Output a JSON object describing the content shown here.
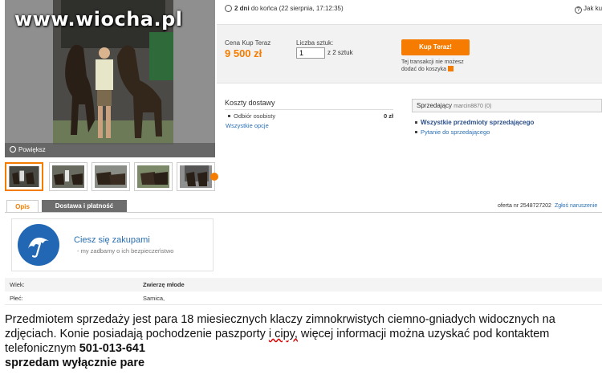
{
  "watermark": "www.wiocha.pl",
  "gallery": {
    "zoom_label": "Powiększ",
    "thumb_count": 5
  },
  "auction": {
    "time_left_bold": "2 dni",
    "time_left_rest": " do końca (22 sierpnia, 17:12:35)",
    "help_label": "Jak ku"
  },
  "buy": {
    "price_label": "Cena Kup Teraz",
    "price": "9 500 zł",
    "qty_label": "Liczba sztuk:",
    "qty_value": "1",
    "qty_of": "z 2 sztuk",
    "buy_button": "Kup Teraz!",
    "cart_note": "Tej transakcji nie możesz dodać do koszyka"
  },
  "shipping": {
    "title": "Koszty dostawy",
    "item": "Odbiór osobisty",
    "price": "0 zł",
    "all_options": "Wszystkie opcje"
  },
  "seller": {
    "label": "Sprzedający",
    "nick": "marcin8870 (0)",
    "all_items": "Wszystkie przedmioty sprzedającego",
    "ask": "Pytanie do sprzedającego"
  },
  "tabs": {
    "opis": "Opis",
    "dostawa": "Dostawa i płatność",
    "offer_number": "oferta nr 2548727202",
    "report": "Zgłoś naruszenie"
  },
  "safety": {
    "title": "Ciesz się zakupami",
    "subtitle": "- my zadbamy o ich bezpieczeństwo"
  },
  "attributes": [
    {
      "key": "Wiek:",
      "value": "Zwierzę młode"
    },
    {
      "key": "Płeć:",
      "value": "Samica,"
    }
  ],
  "description": {
    "part1": "Przedmiotem sprzedaży jest para 18 miesiecznych klaczy zimnokrwistych ciemno-gniadych widocznych na zdjęciach. Konie posiadają pochodzenie  paszporty ",
    "cipy": "i cipy,",
    "part2": " więcej informacji można uzyskać  pod kontaktem telefonicznym ",
    "phone": "501-013-641",
    "last_line": "sprzedam wyłącznie pare"
  },
  "colors": {
    "accent": "#f57c00",
    "link": "#2a6fb3",
    "umbrella": "#2167b4"
  }
}
